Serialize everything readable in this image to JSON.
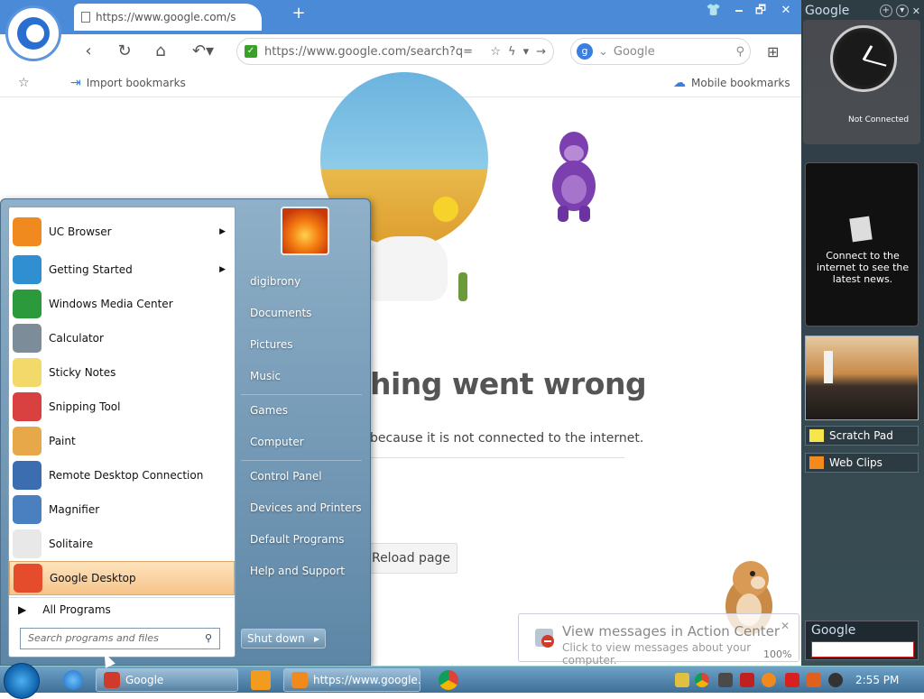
{
  "browser": {
    "tab_title": "https://www.google.com/s",
    "new_tab": "+",
    "window_controls": [
      "🗕",
      "🗗",
      "✕"
    ],
    "address": "https://www.google.com/search?q=",
    "search_engine_icon": "g",
    "search_placeholder": "Google",
    "bookmarks": {
      "import": "Import bookmarks",
      "mobile": "Mobile bookmarks"
    }
  },
  "page": {
    "error_title": "hing went wrong",
    "error_desc": "because it is not connected to the internet.",
    "reload_label": "Reload page"
  },
  "start_menu": {
    "programs": [
      {
        "label": "UC Browser",
        "icon": "uc-browser-icon",
        "color": "#f08a1e",
        "submenu": true
      },
      {
        "label": "Getting Started",
        "icon": "getting-started-icon",
        "color": "#2f8fd0",
        "submenu": true
      },
      {
        "label": "Windows Media Center",
        "icon": "media-center-icon",
        "color": "#2a9a3a",
        "submenu": false
      },
      {
        "label": "Calculator",
        "icon": "calculator-icon",
        "color": "#7d8c99",
        "submenu": false
      },
      {
        "label": "Sticky Notes",
        "icon": "sticky-notes-icon",
        "color": "#f3d86a",
        "submenu": false
      },
      {
        "label": "Snipping Tool",
        "icon": "snipping-tool-icon",
        "color": "#d94040",
        "submenu": false
      },
      {
        "label": "Paint",
        "icon": "paint-icon",
        "color": "#e7a84a",
        "submenu": false
      },
      {
        "label": "Remote Desktop Connection",
        "icon": "remote-desktop-icon",
        "color": "#3c6db0",
        "submenu": false
      },
      {
        "label": "Magnifier",
        "icon": "magnifier-icon",
        "color": "#4a7fc0",
        "submenu": false
      },
      {
        "label": "Solitaire",
        "icon": "solitaire-icon",
        "color": "#e8e8e8",
        "submenu": false
      },
      {
        "label": "Google Desktop",
        "icon": "google-desktop-icon",
        "color": "#e44c2c",
        "submenu": false
      }
    ],
    "all_programs": "All Programs",
    "search_placeholder": "Search programs and files",
    "user": "digibrony",
    "links_group1": [
      "Documents",
      "Pictures",
      "Music"
    ],
    "links_group2": [
      "Games",
      "Computer"
    ],
    "links_group3": [
      "Control Panel",
      "Devices and Printers",
      "Default Programs",
      "Help and Support"
    ],
    "shutdown": "Shut down"
  },
  "sidebar": {
    "title": "Google",
    "clock_status": "Not Connected",
    "news_text": "Connect to the internet to see the latest news.",
    "items": [
      "Scratch Pad",
      "Web Clips"
    ],
    "search_label": "Google"
  },
  "toast": {
    "title": "View messages in Action Center",
    "subtitle": "Click to view messages about your computer.",
    "zoom": "100%"
  },
  "taskbar": {
    "google_label": "Google",
    "uc_label": "https://www.google....",
    "time": "2:55 PM"
  }
}
